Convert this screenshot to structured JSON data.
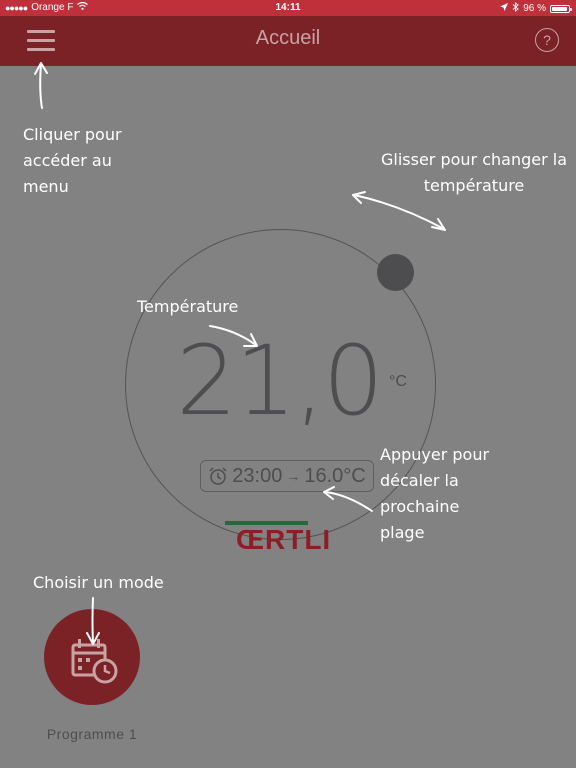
{
  "status_bar": {
    "carrier": "Orange F",
    "time": "14:11",
    "battery": "96 %",
    "battery_level": 0.96
  },
  "nav": {
    "title": "Accueil",
    "help_label": "?"
  },
  "annotations": {
    "menu": [
      "Cliquer pour",
      "accéder au",
      "menu"
    ],
    "slide": [
      "Glisser pour changer la",
      "température"
    ],
    "temperature": "Température",
    "shift": [
      "Appuyer pour",
      "décaler la",
      "prochaine",
      "plage"
    ],
    "mode": "Choisir un mode"
  },
  "thermostat": {
    "temperature": "21,0",
    "unit": "°C",
    "next_time": "23:00",
    "arrow": "→",
    "next_temperature": "16.0°C"
  },
  "brand": {
    "name": "ŒRTLI",
    "color": "#8c1f26",
    "line_color": "#1f6b3a"
  },
  "mode": {
    "label": "Programme 1",
    "icon": "calendar-clock-icon"
  },
  "colors": {
    "accent": "#7b2227",
    "status_bar": "#c0303a",
    "background": "#828282"
  }
}
